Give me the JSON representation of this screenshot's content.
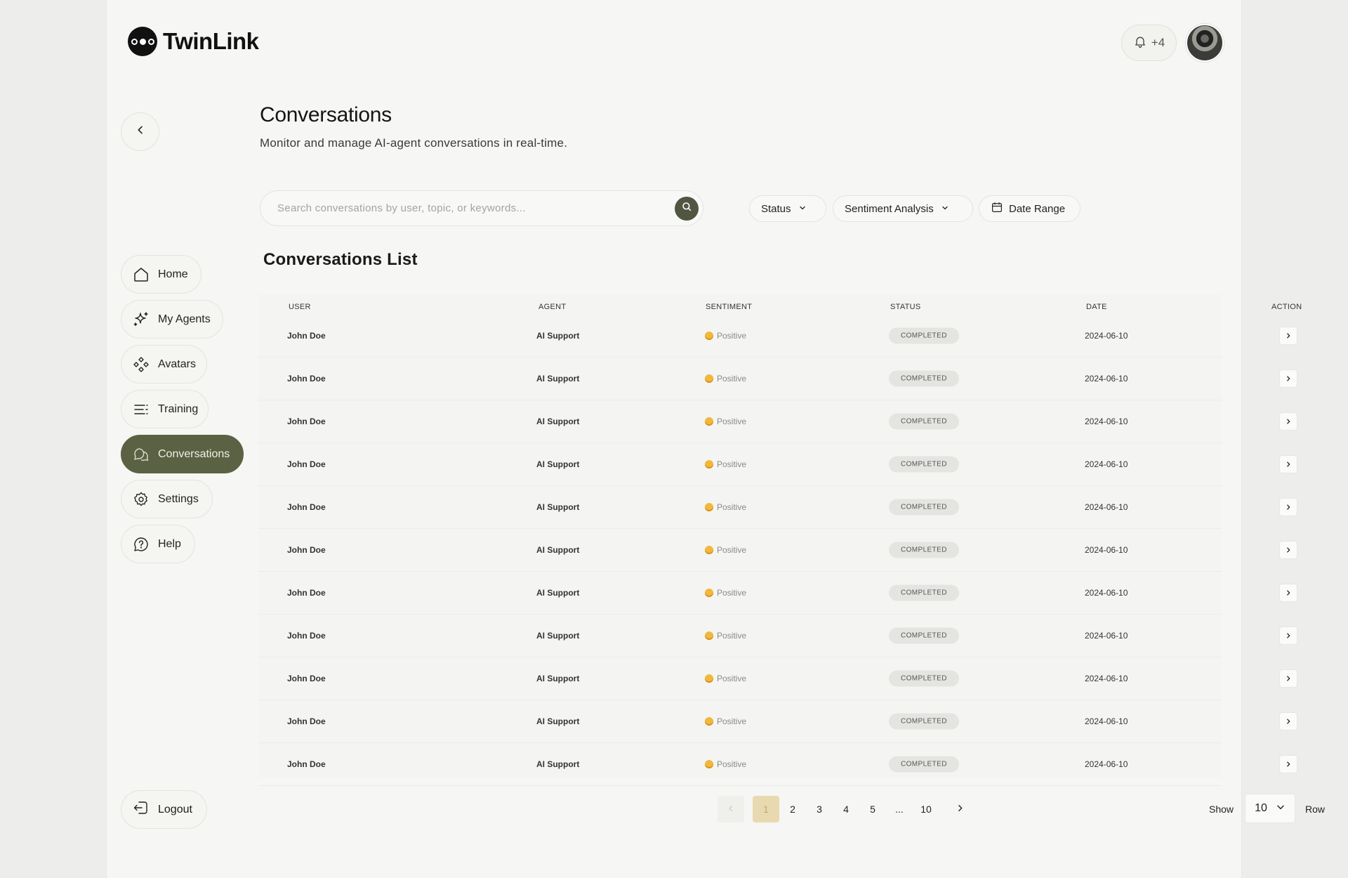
{
  "brand": {
    "name": "TwinLink"
  },
  "header": {
    "notification_count": "+4"
  },
  "page": {
    "title": "Conversations",
    "subtitle": "Monitor and manage AI-agent conversations in real-time."
  },
  "nav": {
    "items": [
      {
        "label": "Home",
        "icon": "home-icon"
      },
      {
        "label": "My Agents",
        "icon": "sparkle-icon"
      },
      {
        "label": "Avatars",
        "icon": "diamond-grid-icon"
      },
      {
        "label": "Training",
        "icon": "list-icon"
      },
      {
        "label": "Conversations",
        "icon": "chat-bubbles-icon",
        "active": true
      },
      {
        "label": "Settings",
        "icon": "gear-icon"
      },
      {
        "label": "Help",
        "icon": "help-chat-icon"
      }
    ],
    "logout": "Logout"
  },
  "search": {
    "placeholder": "Search conversations by user, topic, or keywords..."
  },
  "filters": {
    "status": "Status",
    "sentiment": "Sentiment Analysis",
    "date_range": "Date Range"
  },
  "list": {
    "title": "Conversations List",
    "columns": [
      "USER",
      "AGENT",
      "SENTIMENT",
      "STATUS",
      "DATE",
      "ACTION"
    ],
    "rows": [
      {
        "user": "John Doe",
        "agent": "AI Support",
        "sentiment": "Positive",
        "status": "COMPLETED",
        "date": "2024-06-10"
      },
      {
        "user": "John Doe",
        "agent": "AI Support",
        "sentiment": "Positive",
        "status": "COMPLETED",
        "date": "2024-06-10"
      },
      {
        "user": "John Doe",
        "agent": "AI Support",
        "sentiment": "Positive",
        "status": "COMPLETED",
        "date": "2024-06-10"
      },
      {
        "user": "John Doe",
        "agent": "AI Support",
        "sentiment": "Positive",
        "status": "COMPLETED",
        "date": "2024-06-10"
      },
      {
        "user": "John Doe",
        "agent": "AI Support",
        "sentiment": "Positive",
        "status": "COMPLETED",
        "date": "2024-06-10"
      },
      {
        "user": "John Doe",
        "agent": "AI Support",
        "sentiment": "Positive",
        "status": "COMPLETED",
        "date": "2024-06-10"
      },
      {
        "user": "John Doe",
        "agent": "AI Support",
        "sentiment": "Positive",
        "status": "COMPLETED",
        "date": "2024-06-10"
      },
      {
        "user": "John Doe",
        "agent": "AI Support",
        "sentiment": "Positive",
        "status": "COMPLETED",
        "date": "2024-06-10"
      },
      {
        "user": "John Doe",
        "agent": "AI Support",
        "sentiment": "Positive",
        "status": "COMPLETED",
        "date": "2024-06-10"
      },
      {
        "user": "John Doe",
        "agent": "AI Support",
        "sentiment": "Positive",
        "status": "COMPLETED",
        "date": "2024-06-10"
      },
      {
        "user": "John Doe",
        "agent": "AI Support",
        "sentiment": "Positive",
        "status": "COMPLETED",
        "date": "2024-06-10"
      }
    ]
  },
  "pagination": {
    "pages": [
      "1",
      "2",
      "3",
      "4",
      "5",
      "...",
      "10"
    ],
    "current": "1",
    "show_label": "Show",
    "rows_per_page": "10",
    "row_label": "Row"
  },
  "colors": {
    "accent": "#5b6243",
    "active_page": "#e9d9b1",
    "background": "#f6f6f4"
  }
}
